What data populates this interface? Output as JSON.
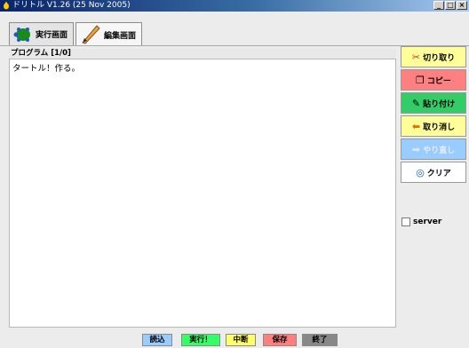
{
  "window": {
    "title": "ドリトル V1.26 (25 Nov 2005)",
    "buttons": [
      "_",
      "□",
      "×"
    ]
  },
  "tabs": [
    {
      "label": "実行画面",
      "icon": "turtle-icon"
    },
    {
      "label": "編集画面",
      "icon": "pencil-icon"
    }
  ],
  "editor": {
    "label": "プログラム [1/0]",
    "content": "タートル！作る。"
  },
  "sidebar": {
    "buttons": [
      {
        "label": "切り取り",
        "icon": "scissors-icon",
        "color": "#ffff99"
      },
      {
        "label": "コピー",
        "icon": "copy-icon",
        "color": "#ff8080"
      },
      {
        "label": "貼り付け",
        "icon": "paste-icon",
        "color": "#33cc66"
      },
      {
        "label": "取り消し",
        "icon": "undo-arrow-icon",
        "color": "#ffff99"
      },
      {
        "label": "やり直し",
        "icon": "redo-arrow-icon",
        "color": "#99ccff"
      },
      {
        "label": "クリア",
        "icon": "clear-icon",
        "color": "#ffffff"
      }
    ],
    "server_label": "server"
  },
  "bottom": {
    "buttons": [
      {
        "label": "読込",
        "color": "#99ccff"
      },
      {
        "label": "実行！",
        "color": "#33ff66"
      },
      {
        "label": "中断",
        "color": "#ffff66"
      },
      {
        "label": "保存",
        "color": "#ff7f7f"
      },
      {
        "label": "終了",
        "color": "#888888"
      }
    ]
  }
}
